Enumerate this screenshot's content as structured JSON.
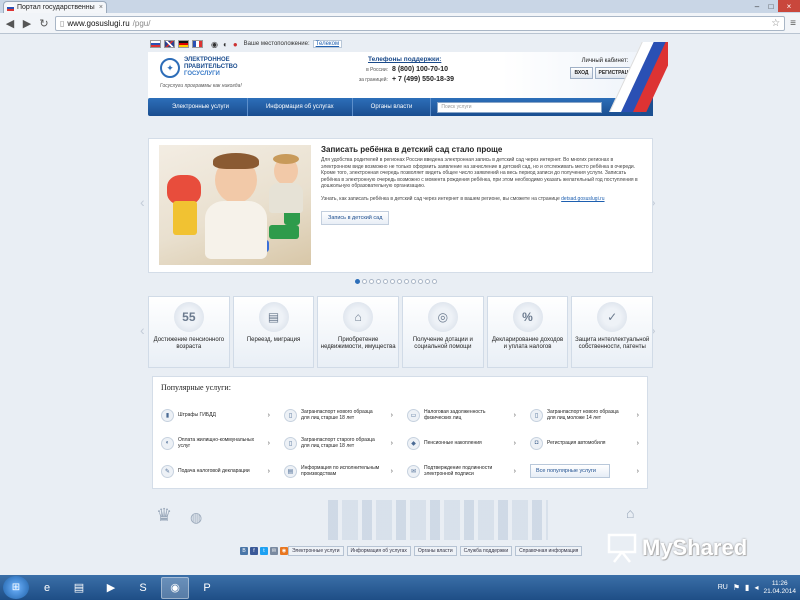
{
  "browser": {
    "tab_title": "Портал государственны",
    "tab_close": "×",
    "url_host": "www.gosuslugi.ru",
    "url_path": "/pgu/",
    "window_controls": [
      "–",
      "□",
      "×"
    ]
  },
  "topbar": {
    "location_label": "Ваше местоположение:",
    "location_value": "Телеком"
  },
  "header": {
    "logo_line1": "ЭЛЕКТРОННОЕ",
    "logo_line2": "ПРАВИТЕЛЬСТВО",
    "logo_line3": "ГОСУСЛУГИ",
    "slogan": "Госуслуги программы как никогда!",
    "support_title": "Телефоны поддержки:",
    "phones": [
      {
        "label": "в России:",
        "number": "8 (800) 100-70-10"
      },
      {
        "label": "за границей:",
        "number": "+ 7 (499) 550-18-39"
      }
    ],
    "cabinet_title": "Личный кабинет:",
    "login_button": "ВХОД",
    "register_button": "РЕГИСТРАЦИЯ"
  },
  "navbar": {
    "items": [
      "Электронные услуги",
      "Информация об услугах",
      "Органы власти"
    ],
    "search_placeholder": "Поиск услуги"
  },
  "banner": {
    "title": "Записать ребёнка в детский сад стало проще",
    "text": "Для удобства родителей в регионах России введена электронная запись в детский сад через интернет. Во многих регионах в электронном виде возможно не только оформить заявление на зачисление в детский сад, но и отслеживать место ребёнка в очереди. Кроме того, электронная очередь позволяет видеть общее число заявлений на весь период записи до получения услуги. Записать ребёнка в электронную очередь возможно с момента рождения ребёнка, при этом необходимо указать желательный год поступления в дошкольную образовательную организацию.",
    "text2_prefix": "Узнать, как записать ребёнка в детский сад через интернет в вашем регионе, вы сможете на странице",
    "text2_link": "detsad.gosuslugi.ru",
    "button": "Запись в детский сад",
    "slide_count": 12,
    "active_slide": 1
  },
  "categories": [
    {
      "label": "Достижение пенсионного возраста",
      "icon": "55"
    },
    {
      "label": "Переезд, миграция",
      "icon": "▤"
    },
    {
      "label": "Приобретение недвижимости, имущества",
      "icon": "⌂"
    },
    {
      "label": "Получение дотации и социальной помощи",
      "icon": "◎"
    },
    {
      "label": "Декларирование доходов и уплата налогов",
      "icon": "%"
    },
    {
      "label": "Защита интеллектуальной собственности, патенты",
      "icon": "✓"
    }
  ],
  "popular": {
    "title": "Популярные услуги:",
    "items": [
      {
        "label": "Штрафы ГИБДД",
        "icon": "▮"
      },
      {
        "label": "Загранпаспорт нового образца для лиц старше 18 лет",
        "icon": "▯"
      },
      {
        "label": "Налоговая задолженность физических лиц",
        "icon": "▭"
      },
      {
        "label": "Загранпаспорт нового образца для лиц моложе 14 лет",
        "icon": "▯"
      },
      {
        "label": "Оплата жилищно-коммунальных услуг",
        "icon": "◐"
      },
      {
        "label": "Загранпаспорт старого образца для лиц старше 18 лет",
        "icon": "▯"
      },
      {
        "label": "Пенсионные накопления",
        "icon": "◆"
      },
      {
        "label": "Регистрация автомобиля",
        "icon": "◘"
      },
      {
        "label": "Подача налоговой декларации",
        "icon": "✎"
      },
      {
        "label": "Информация по исполнительным производствам",
        "icon": "▤"
      },
      {
        "label": "Подтверждение подлинности электронной подписи",
        "icon": "✉"
      }
    ],
    "all_button": "Все популярные услуги"
  },
  "footer": {
    "links": [
      "Электронные услуги",
      "Информация об услугах",
      "Органы власти",
      "Служба поддержки",
      "Справочная информация"
    ],
    "social": [
      "В",
      "f",
      "t",
      "✉",
      "◉"
    ]
  },
  "watermark": "MyShared",
  "taskbar": {
    "lang": "RU",
    "time": "11:26",
    "date": "21.04.2014"
  },
  "colors": {
    "nav_blue": "#1a4d8f",
    "link_blue": "#1d5fb0",
    "flag_red": "#d33",
    "flag_blue": "#2a50b4"
  }
}
